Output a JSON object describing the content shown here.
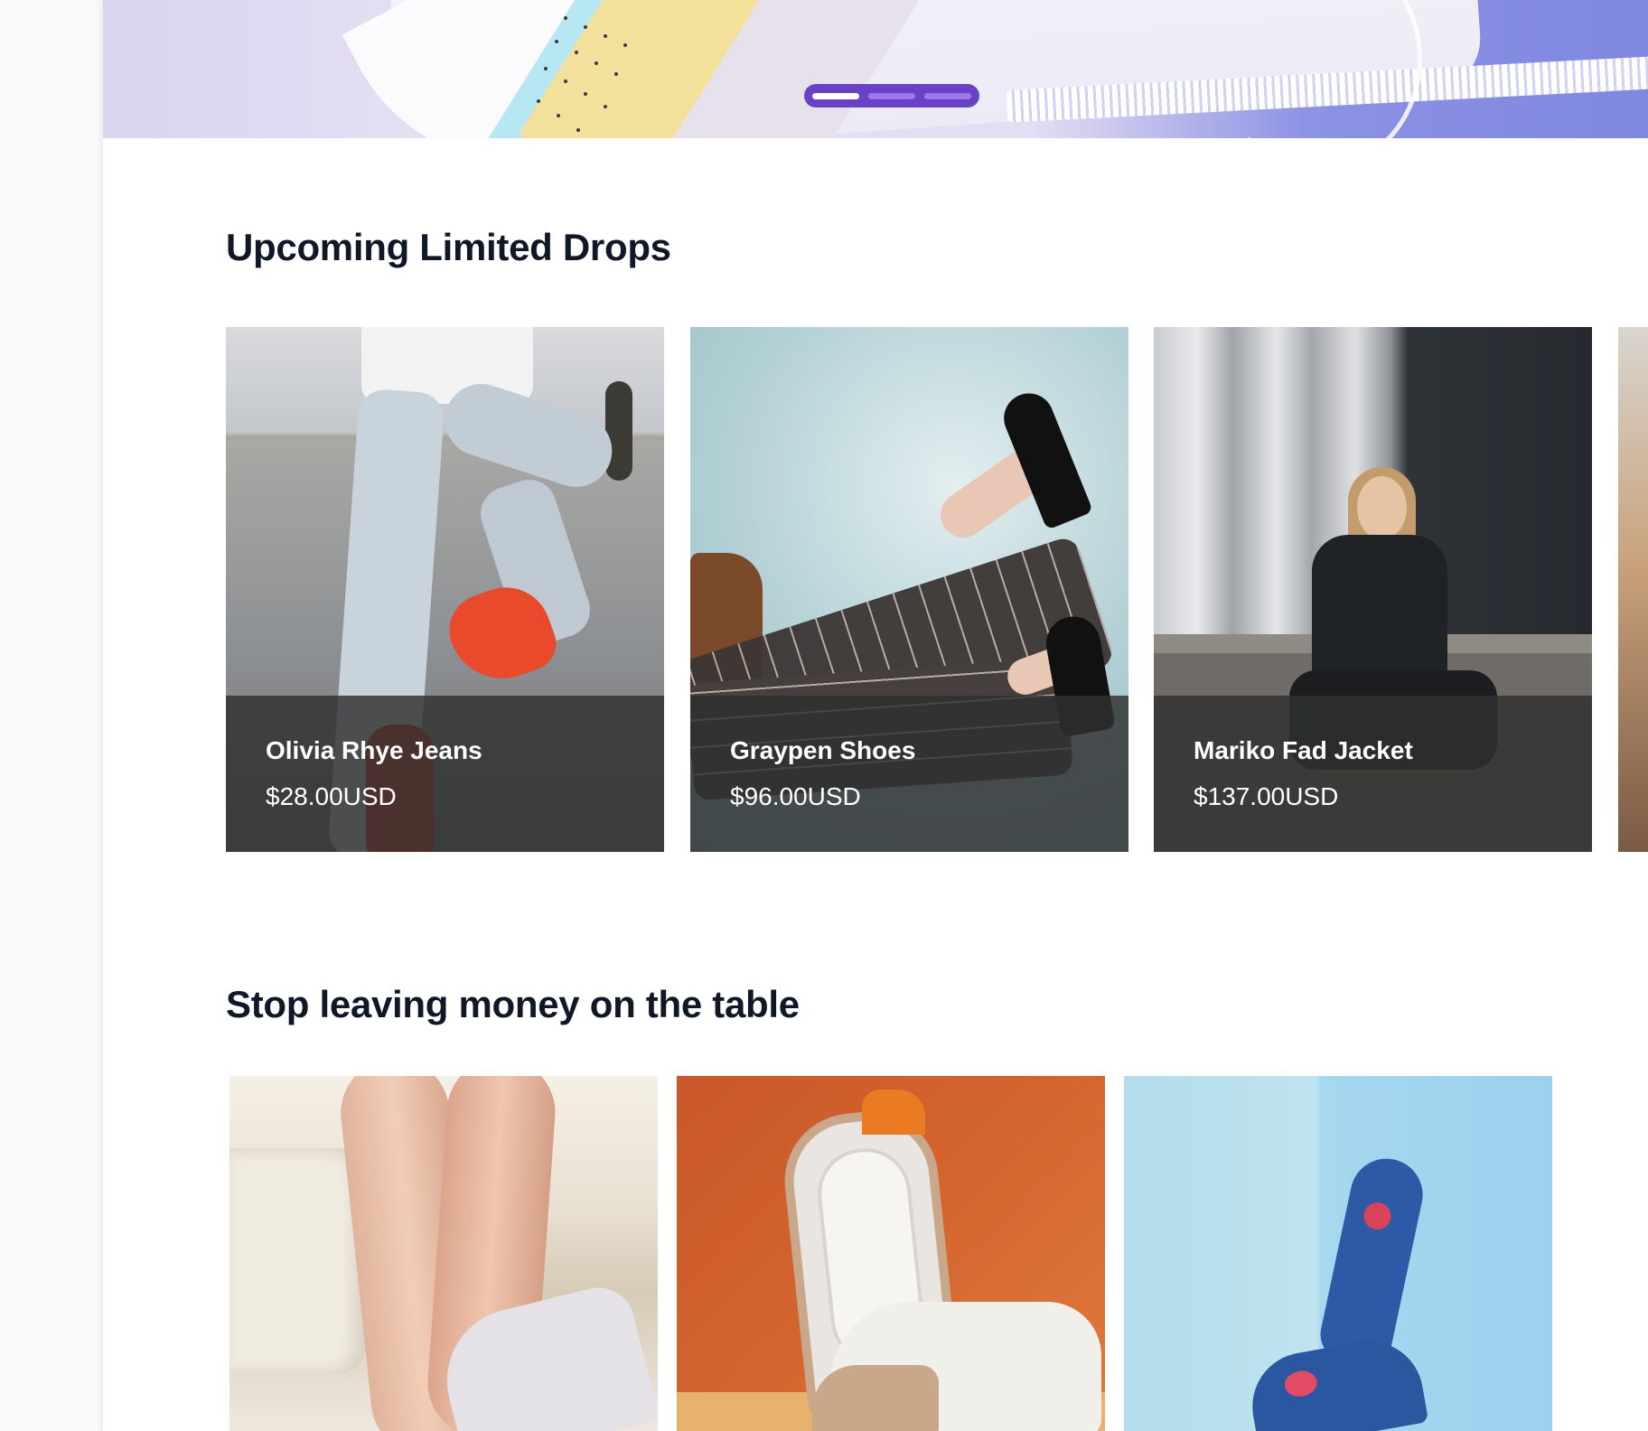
{
  "hero": {
    "carousel": {
      "slide_count": 3,
      "active_index": 0
    },
    "colors": {
      "pager_bg": "#6941c6",
      "pager_dot": "#9e77ed",
      "pager_active": "#ffffff"
    }
  },
  "drops": {
    "title": "Upcoming Limited Drops",
    "items": [
      {
        "name": "Olivia Rhye Jeans",
        "price": "$28.00USD"
      },
      {
        "name": "Graypen Shoes",
        "price": "$96.00USD"
      },
      {
        "name": "Mariko Fad Jacket",
        "price": "$137.00USD"
      }
    ]
  },
  "deals": {
    "title": "Stop leaving money on the table"
  }
}
